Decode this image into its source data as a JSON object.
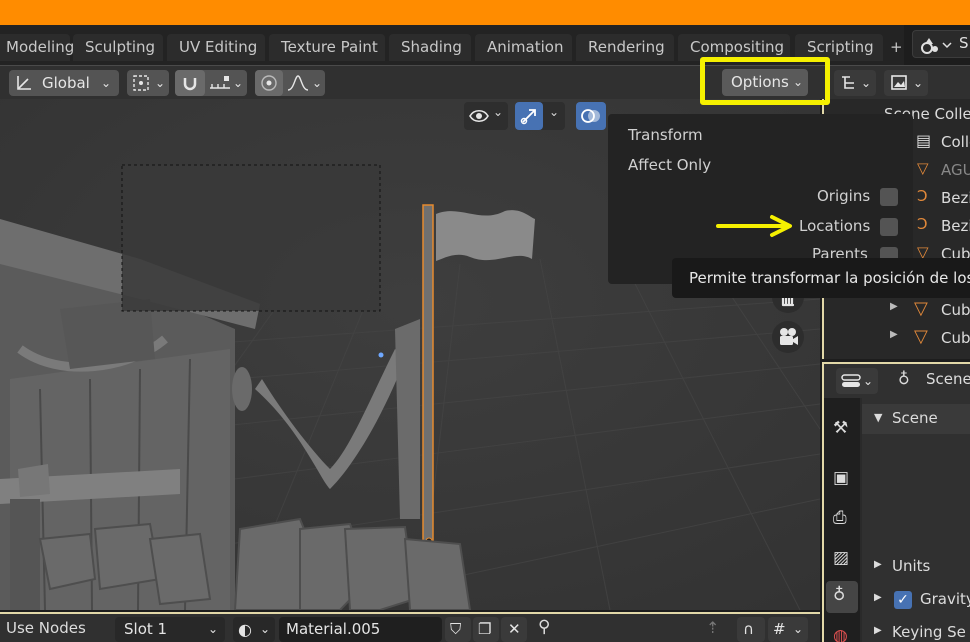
{
  "workspace_tabs": [
    "Modeling",
    "Sculpting",
    "UV Editing",
    "Texture Paint",
    "Shading",
    "Animation",
    "Rendering",
    "Compositing",
    "Scripting",
    "+"
  ],
  "scene_chip": {
    "label": "S"
  },
  "header": {
    "orientation": "Global",
    "options_label": "Options"
  },
  "dropdown": {
    "transform_label": "Transform",
    "affect_only_label": "Affect Only",
    "origins_label": "Origins",
    "locations_label": "Locations",
    "parents_label": "Parents"
  },
  "tooltip": {
    "text": "Permite transformar la posición de los o"
  },
  "outliner": {
    "title": "Scene Collec",
    "rows": [
      "Colle",
      "AGU",
      "Bezi",
      "Bezi",
      "Cube",
      "Cube",
      "Cube"
    ]
  },
  "properties": {
    "context_label": "Scene",
    "panel_title": "Scene",
    "sections": [
      "Units",
      "Gravity",
      "Keying Se"
    ],
    "gravity_checked": true
  },
  "bottombar": {
    "use_nodes": "Use Nodes",
    "slot": "Slot 1",
    "material": "Material.005"
  },
  "colors": {
    "accent_orange": "#ff8c00",
    "highlight_yellow": "#f5f000",
    "selected_blue": "#4772b3"
  }
}
